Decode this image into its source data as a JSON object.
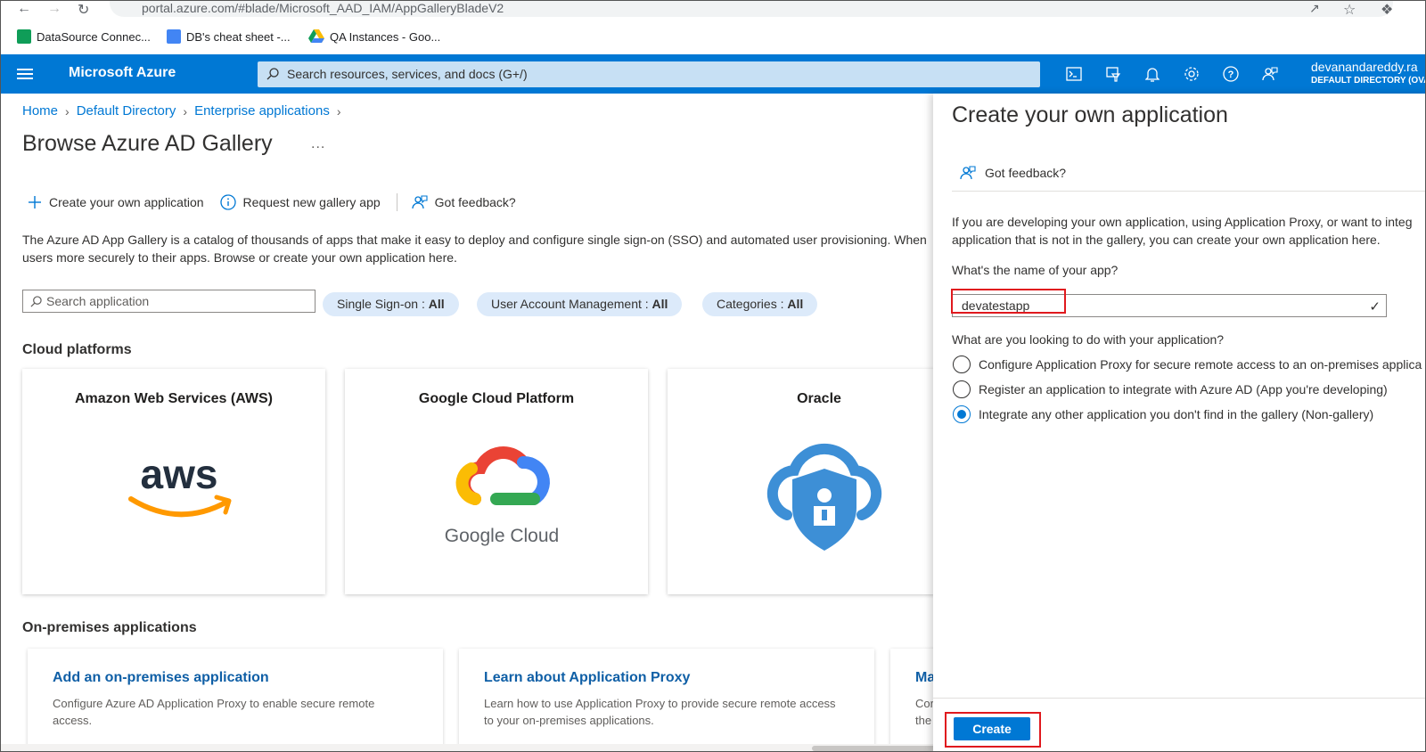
{
  "browser": {
    "url": "portal.azure.com/#blade/Microsoft_AAD_IAM/AppGalleryBladeV2",
    "bookmarks": [
      {
        "label": "DataSource Connec...",
        "icon": "sheets-icon",
        "color": "#0f9d58"
      },
      {
        "label": "DB's cheat sheet -...",
        "icon": "docs-icon",
        "color": "#4285f4"
      },
      {
        "label": "QA Instances - Goo...",
        "icon": "drive-icon",
        "color": "#fbbc04"
      }
    ]
  },
  "header": {
    "brand": "Microsoft Azure",
    "search_placeholder": "Search resources, services, and docs (G+/)",
    "user_name": "devanandareddy.ra",
    "user_directory": "DEFAULT DIRECTORY (OVA",
    "icons": [
      "cloud-shell-icon",
      "directory-filter-icon",
      "notifications-icon",
      "settings-icon",
      "help-icon",
      "feedback-icon"
    ],
    "accent": "#0078d4"
  },
  "breadcrumb": [
    "Home",
    "Default Directory",
    "Enterprise applications"
  ],
  "page": {
    "title": "Browse Azure AD Gallery",
    "ellipsis": "...",
    "commands": {
      "create": "Create your own application",
      "request": "Request new gallery app",
      "feedback": "Got feedback?"
    },
    "description_line1": "The Azure AD App Gallery is a catalog of thousands of apps that make it easy to deploy and configure single sign-on (SSO) and automated user provisioning. When",
    "description_line2": "users more securely to their apps. Browse or create your own application here.",
    "search_placeholder": "Search application",
    "filters": [
      {
        "label": "Single Sign-on : ",
        "value": "All"
      },
      {
        "label": "User Account Management : ",
        "value": "All"
      },
      {
        "label": "Categories : ",
        "value": "All"
      }
    ],
    "cloud_section": "Cloud platforms",
    "cloud_cards": [
      {
        "title": "Amazon Web Services (AWS)",
        "logo": "aws-logo"
      },
      {
        "title": "Google Cloud Platform",
        "logo": "google-cloud-logo"
      },
      {
        "title": "Oracle",
        "logo": "oracle-logo"
      }
    ],
    "google_cloud_wordmark": "Google Cloud",
    "aws_wordmark": "aws",
    "onprem_section": "On-premises applications",
    "onprem_cards": [
      {
        "title": "Add an on-premises application",
        "desc": "Configure Azure AD Application Proxy to enable secure remote access."
      },
      {
        "title": "Learn about Application Proxy",
        "desc": "Learn how to use Application Proxy to provide secure remote access to your on-premises applications."
      },
      {
        "title": "Ma",
        "desc": "Cor the"
      }
    ]
  },
  "panel": {
    "title": "Create your own application",
    "feedback": "Got feedback?",
    "desc_line1": "If you are developing your own application, using Application Proxy, or want to integ",
    "desc_line2": "application that is not in the gallery, you can create your own application here.",
    "name_label": "What's the name of your app?",
    "name_value": "devatestapp",
    "purpose_label": "What are you looking to do with your application?",
    "options": [
      {
        "label": "Configure Application Proxy for secure remote access to an on-premises applica",
        "selected": false
      },
      {
        "label": "Register an application to integrate with Azure AD (App you're developing)",
        "selected": false
      },
      {
        "label": "Integrate any other application you don't find in the gallery (Non-gallery)",
        "selected": true
      }
    ],
    "create_label": "Create"
  }
}
